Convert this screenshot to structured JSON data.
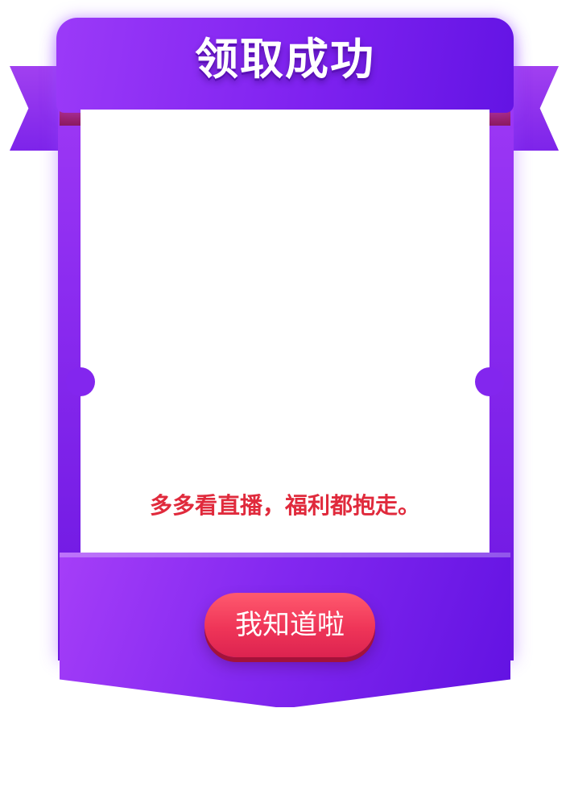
{
  "dialog": {
    "title": "领取成功",
    "message": "多多看直播，福利都抱走。",
    "confirm_label": "我知道啦"
  },
  "colors": {
    "frame_purple": "#8326ee",
    "title_text": "#ffffff",
    "message_red": "#e02a3c",
    "button_red": "#ef3558"
  }
}
